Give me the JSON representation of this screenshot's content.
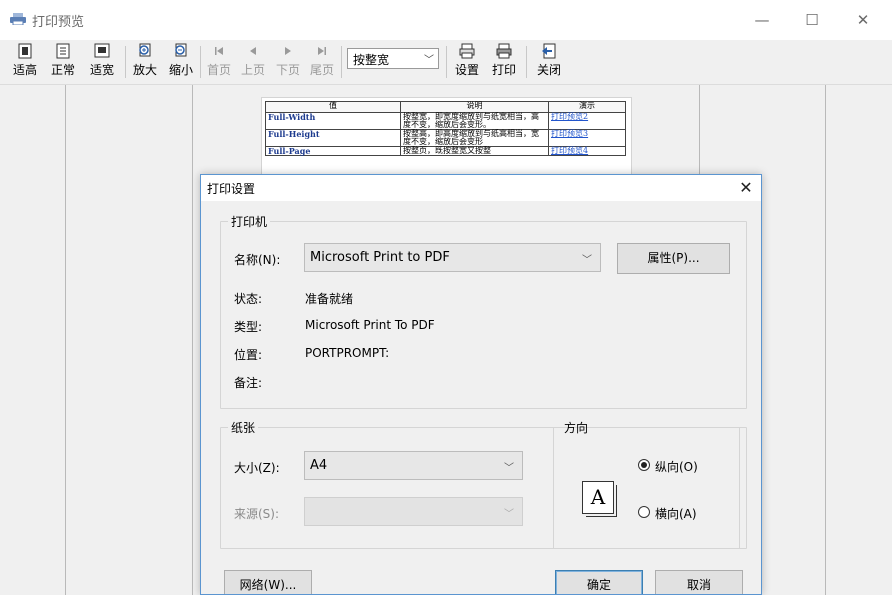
{
  "window": {
    "title": "打印预览",
    "minimize": "—",
    "maximize": "☐",
    "close": "✕"
  },
  "toolbar": {
    "fit_height": "适高",
    "normal": "正常",
    "fit_width": "适宽",
    "zoom_in": "放大",
    "zoom_out": "缩小",
    "first_page": "首页",
    "prev_page": "上页",
    "next_page": "下页",
    "last_page": "尾页",
    "zoom_mode": "按整宽",
    "settings": "设置",
    "print": "打印",
    "close": "关闭"
  },
  "document_table": {
    "headers": [
      "值",
      "说明",
      "演示"
    ],
    "rows": [
      {
        "value": "Full-Width",
        "desc": "按整宽，即宽度缩放到与纸宽相当，高度不变，缩放后会变形。",
        "link": "打印预览2"
      },
      {
        "value": "Full-Height",
        "desc": "按整高，即高度缩放到与纸高相当，宽度不变，缩放后会变形",
        "link": "打印预览3"
      },
      {
        "value": "Full-Page",
        "desc": "按整页，既按整宽又按整",
        "link": "打印预览4"
      }
    ]
  },
  "dialog": {
    "title": "打印设置",
    "close": "✕",
    "printer_group": "打印机",
    "name_label": "名称(N):",
    "name_value": "Microsoft Print to PDF",
    "properties_button": "属性(P)...",
    "status_label": "状态:",
    "status_value": "准备就绪",
    "type_label": "类型:",
    "type_value": "Microsoft Print To PDF",
    "where_label": "位置:",
    "where_value": "PORTPROMPT:",
    "comment_label": "备注:",
    "comment_value": "",
    "paper_group": "纸张",
    "size_label": "大小(Z):",
    "size_value": "A4",
    "source_label": "来源(S):",
    "source_value": "",
    "orientation_group": "方向",
    "orientation_icon_letter": "A",
    "portrait": "纵向(O)",
    "landscape": "横向(A)",
    "network_button": "网络(W)...",
    "ok_button": "确定",
    "cancel_button": "取消"
  }
}
